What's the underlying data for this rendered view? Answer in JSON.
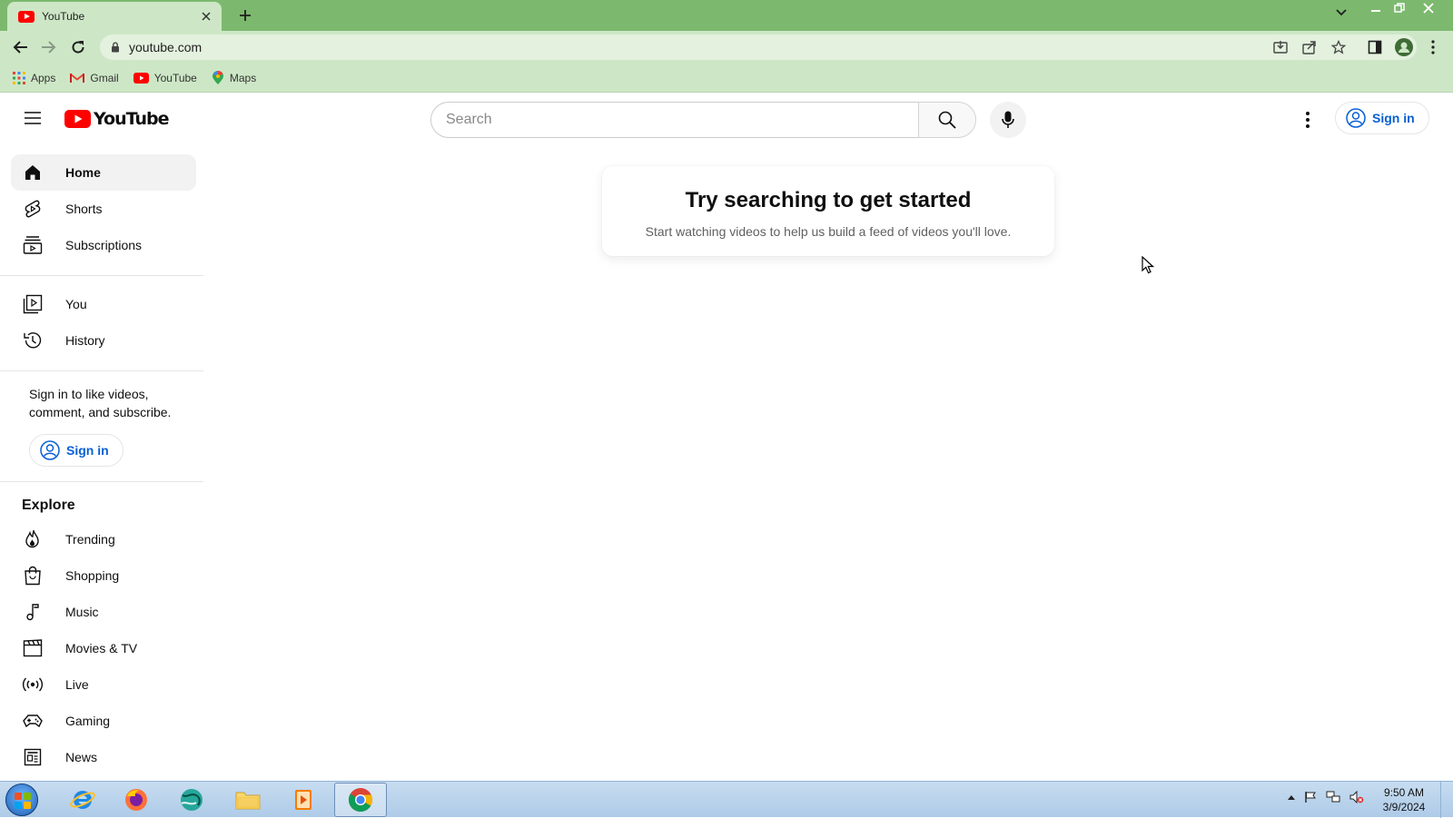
{
  "browser": {
    "tab_title": "YouTube",
    "url": "youtube.com",
    "bookmarks": [
      {
        "label": "Apps",
        "icon": "apps-grid-icon"
      },
      {
        "label": "Gmail",
        "icon": "gmail-icon"
      },
      {
        "label": "YouTube",
        "icon": "youtube-icon"
      },
      {
        "label": "Maps",
        "icon": "maps-icon"
      }
    ],
    "frame_color": "#7cb96e",
    "toolbar_color": "#cde7c6"
  },
  "header": {
    "logo_text": "YouTube",
    "search_placeholder": "Search",
    "signin_label": "Sign in"
  },
  "sidebar": {
    "primary": [
      {
        "label": "Home",
        "icon": "home-icon",
        "active": true
      },
      {
        "label": "Shorts",
        "icon": "shorts-icon"
      },
      {
        "label": "Subscriptions",
        "icon": "subscriptions-icon"
      }
    ],
    "you": [
      {
        "label": "You",
        "icon": "you-library-icon"
      },
      {
        "label": "History",
        "icon": "history-icon"
      }
    ],
    "signin_prompt": "Sign in to like videos, comment, and subscribe.",
    "signin_label": "Sign in",
    "explore_heading": "Explore",
    "explore": [
      {
        "label": "Trending",
        "icon": "trending-icon"
      },
      {
        "label": "Shopping",
        "icon": "shopping-bag-icon"
      },
      {
        "label": "Music",
        "icon": "music-note-icon"
      },
      {
        "label": "Movies & TV",
        "icon": "clapperboard-icon"
      },
      {
        "label": "Live",
        "icon": "live-broadcast-icon"
      },
      {
        "label": "Gaming",
        "icon": "gamepad-icon"
      },
      {
        "label": "News",
        "icon": "news-icon"
      }
    ]
  },
  "main": {
    "prompt_title": "Try searching to get started",
    "prompt_subtitle": "Start watching videos to help us build a feed of videos you'll love."
  },
  "taskbar": {
    "apps": [
      "internet-explorer-icon",
      "firefox-icon",
      "app-globe-icon",
      "file-explorer-icon",
      "media-player-icon",
      "chrome-icon"
    ],
    "time": "9:50 AM",
    "date": "3/9/2024"
  },
  "colors": {
    "youtube_red": "#ff0000",
    "link_blue": "#065fd4",
    "text_primary": "#0f0f0f",
    "text_secondary": "#606060"
  }
}
